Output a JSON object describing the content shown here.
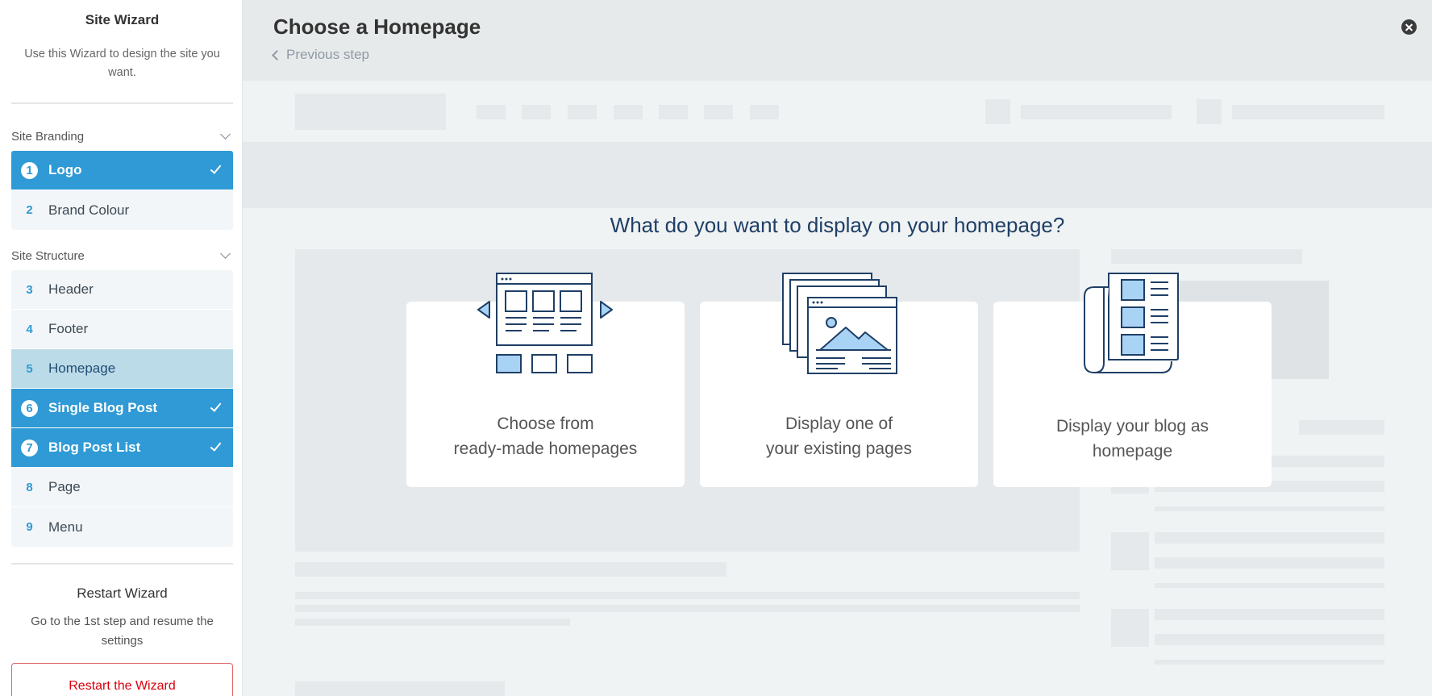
{
  "sidebar": {
    "title": "Site Wizard",
    "description": "Use this Wizard to design the site you want.",
    "sections": [
      {
        "title": "Site Branding",
        "steps": [
          {
            "num": "1",
            "label": "Logo",
            "state": "done"
          },
          {
            "num": "2",
            "label": "Brand Colour",
            "state": "todo"
          }
        ]
      },
      {
        "title": "Site Structure",
        "steps": [
          {
            "num": "3",
            "label": "Header",
            "state": "todo"
          },
          {
            "num": "4",
            "label": "Footer",
            "state": "todo"
          },
          {
            "num": "5",
            "label": "Homepage",
            "state": "active"
          },
          {
            "num": "6",
            "label": "Single Blog Post",
            "state": "done"
          },
          {
            "num": "7",
            "label": "Blog Post List",
            "state": "done"
          },
          {
            "num": "8",
            "label": "Page",
            "state": "todo"
          },
          {
            "num": "9",
            "label": "Menu",
            "state": "todo"
          }
        ]
      }
    ],
    "restart": {
      "title": "Restart Wizard",
      "description": "Go to the 1st step and resume the settings",
      "button": "Restart the Wizard"
    }
  },
  "main": {
    "title": "Choose a Homepage",
    "previous_step": "Previous step",
    "question": "What do you want to display on your homepage?",
    "options": [
      {
        "line1": "Choose from",
        "line2": "ready-made homepages",
        "icon": "template-gallery-icon"
      },
      {
        "line1": "Display one of",
        "line2": "your existing pages",
        "icon": "stacked-pages-icon"
      },
      {
        "line1": "Display your blog as",
        "line2": "homepage",
        "icon": "blog-newspaper-icon"
      }
    ]
  },
  "colors": {
    "accent": "#2f9ad5",
    "active_step": "#bcdbe8",
    "heading": "#1f3f66",
    "danger": "#d8000c"
  }
}
